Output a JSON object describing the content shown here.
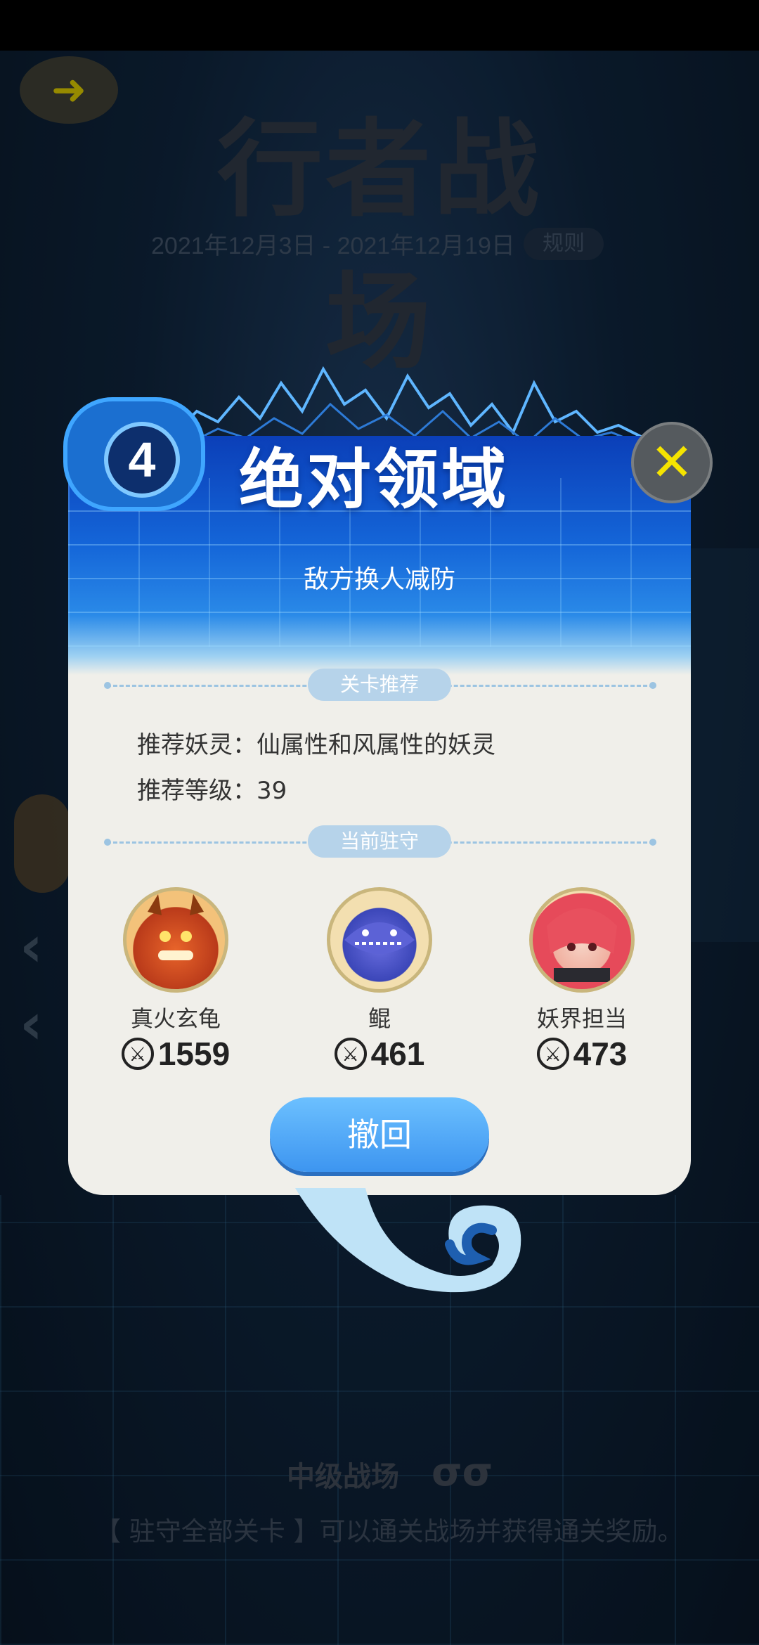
{
  "background": {
    "title": "行者战场",
    "date_range": "2021年12月3日 - 2021年12月19日",
    "rule_label": "规则",
    "level_name": "中级战场",
    "level_icons": "σσ",
    "footer_text": "【 驻守全部关卡 】可以通关战场并获得通关奖励。"
  },
  "dialog": {
    "stage_number": "4",
    "title": "绝对领域",
    "subtitle": "敌方换人减防",
    "close_label": "✕",
    "section_recommend": "关卡推荐",
    "recommend_spirit": "推荐妖灵：仙属性和风属性的妖灵",
    "recommend_level": "推荐等级：39",
    "section_garrison": "当前驻守",
    "heroes": [
      {
        "name": "真火玄龟",
        "power": "1559"
      },
      {
        "name": "鲲",
        "power": "461"
      },
      {
        "name": "妖界担当",
        "power": "473"
      }
    ],
    "revoke_label": "撤回"
  },
  "colors": {
    "accent_blue": "#3d95f0",
    "close_x": "#f5e400",
    "pill_bg": "#b6d3ea",
    "dialog_bg": "#f0efea"
  }
}
